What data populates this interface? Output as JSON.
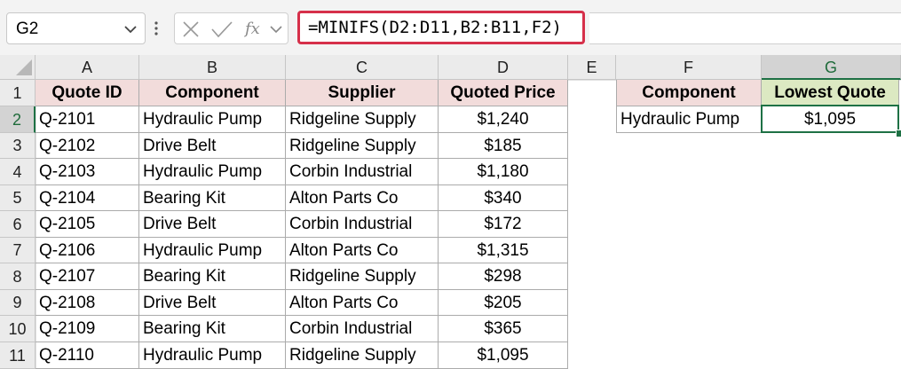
{
  "name_box": {
    "value": "G2"
  },
  "formula_bar": {
    "cancel_icon": "x-icon",
    "enter_icon": "check-icon",
    "function_icon": "fx-icon",
    "formula": "=MINIFS(D2:D11,B2:B11,F2)"
  },
  "column_headers": [
    "A",
    "B",
    "C",
    "D",
    "E",
    "F",
    "G"
  ],
  "row_headers": [
    "1",
    "2",
    "3",
    "4",
    "5",
    "6",
    "7",
    "8",
    "9",
    "10",
    "11"
  ],
  "table": {
    "headers": [
      "Quote ID",
      "Component",
      "Supplier",
      "Quoted Price"
    ],
    "rows": [
      [
        "Q-2101",
        "Hydraulic Pump",
        "Ridgeline Supply",
        "$1,240"
      ],
      [
        "Q-2102",
        "Drive Belt",
        "Ridgeline Supply",
        "$185"
      ],
      [
        "Q-2103",
        "Hydraulic Pump",
        "Corbin Industrial",
        "$1,180"
      ],
      [
        "Q-2104",
        "Bearing Kit",
        "Alton Parts Co",
        "$340"
      ],
      [
        "Q-2105",
        "Drive Belt",
        "Corbin Industrial",
        "$172"
      ],
      [
        "Q-2106",
        "Hydraulic Pump",
        "Alton Parts Co",
        "$1,315"
      ],
      [
        "Q-2107",
        "Bearing Kit",
        "Ridgeline Supply",
        "$298"
      ],
      [
        "Q-2108",
        "Drive Belt",
        "Alton Parts Co",
        "$205"
      ],
      [
        "Q-2109",
        "Bearing Kit",
        "Corbin Industrial",
        "$365"
      ],
      [
        "Q-2110",
        "Hydraulic Pump",
        "Ridgeline Supply",
        "$1,095"
      ]
    ]
  },
  "lookup": {
    "headers": [
      "Component",
      "Lowest Quote"
    ],
    "values": [
      "Hydraulic Pump",
      "$1,095"
    ]
  },
  "colors": {
    "header_fill": "#f2dcdb",
    "result_header_fill": "#dce9c2",
    "highlight_border": "#d6304a",
    "selection": "#1e7145"
  }
}
